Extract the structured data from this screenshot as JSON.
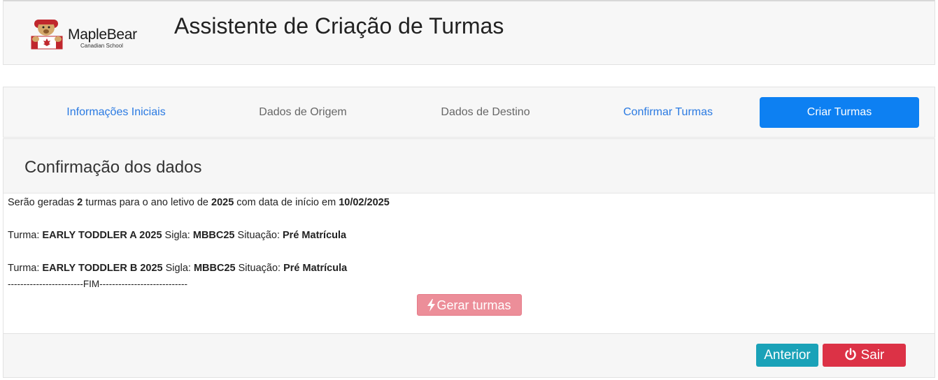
{
  "brand": {
    "logo_text": "MapleBear",
    "logo_sub": "Canadian School"
  },
  "header": {
    "title": "Assistente de Criação de Turmas"
  },
  "steps": [
    {
      "label": "Informações Iniciais",
      "state": "link"
    },
    {
      "label": "Dados de Origem",
      "state": "disabled"
    },
    {
      "label": "Dados de Destino",
      "state": "disabled"
    },
    {
      "label": "Confirmar Turmas",
      "state": "link"
    },
    {
      "label": "Criar Turmas",
      "state": "active"
    }
  ],
  "panel": {
    "title": "Confirmação dos dados",
    "summary": {
      "p1": "Serão geradas ",
      "count": "2",
      "p2": " turmas para o ano letivo de ",
      "year": "2025",
      "p3": " com data de início em ",
      "date": "10/02/2025"
    },
    "turmas": [
      {
        "turma_label": "Turma: ",
        "turma": "EARLY TODDLER A 2025",
        "sigla_label": " Sigla: ",
        "sigla": "MBBC25",
        "situacao_label": " Situação: ",
        "situacao": "Pré Matrícula"
      },
      {
        "turma_label": "Turma: ",
        "turma": "EARLY TODDLER B 2025",
        "sigla_label": " Sigla: ",
        "sigla": "MBBC25",
        "situacao_label": " Situação: ",
        "situacao": "Pré Matrícula"
      }
    ],
    "end_marker": "------------------------FIM----------------------------",
    "generate_button": "Gerar turmas"
  },
  "footer": {
    "prev_button": "Anterior",
    "exit_button": "Sair"
  },
  "colors": {
    "active_step": "#0d80f2",
    "link_step": "#2a7ae2",
    "generate_button": "#ec8e99",
    "prev_button": "#1aa2b8",
    "exit_button": "#dc3246"
  },
  "icons": {
    "generate": "bolt-icon",
    "exit": "power-icon",
    "logo": "bear-logo-icon"
  }
}
